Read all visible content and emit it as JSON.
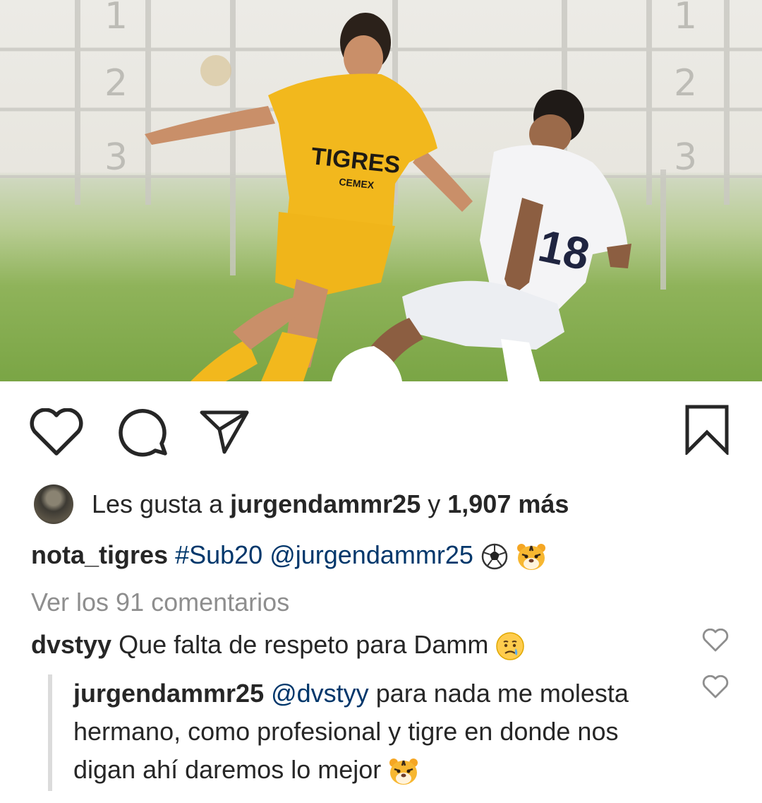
{
  "post": {
    "image_alt": "soccer-match-photo",
    "photo_texts": {
      "jersey_brand": "TIGRES",
      "jersey_sponsor": "CEMEX",
      "jersey_number": "18",
      "board_top": "1",
      "board_mid": "2",
      "board_bottom": "3"
    }
  },
  "actions": {
    "like_icon": "heart-icon",
    "comment_icon": "comment-bubble-icon",
    "share_icon": "paper-plane-icon",
    "save_icon": "bookmark-icon"
  },
  "likes": {
    "prefix": "Les gusta a ",
    "user": "jurgendammr25",
    "middle": " y ",
    "count": "1,907 más"
  },
  "caption": {
    "user": "nota_tigres",
    "hashtag": "#Sub20",
    "mention": "@jurgendammr25",
    "emojis": [
      "soccer-ball-emoji",
      "tiger-face-emoji"
    ]
  },
  "view_comments": "Ver los 91 comentarios",
  "comments": [
    {
      "user": "dvstyy",
      "text": "Que falta de respeto para Damm",
      "emoji": "crying-face-emoji"
    },
    {
      "user": "jurgendammr25",
      "mention": "@dvstyy",
      "text": "para nada me molesta hermano, como profesional y tigre en donde nos digan ahí daremos lo mejor",
      "emoji": "tiger-face-emoji"
    }
  ],
  "colors": {
    "text": "#262626",
    "link": "#00376b",
    "muted": "#8e8e8e",
    "jersey_yellow": "#f2b81d"
  }
}
